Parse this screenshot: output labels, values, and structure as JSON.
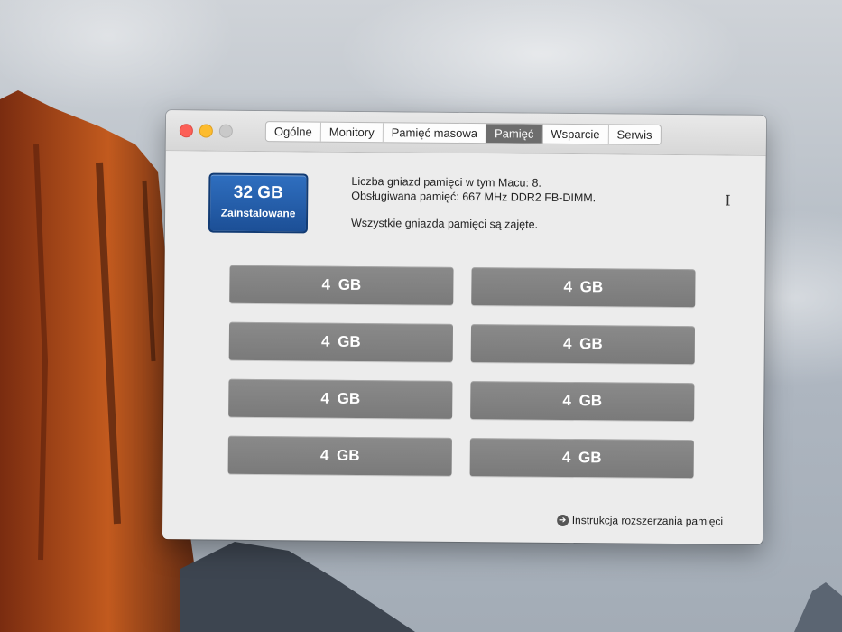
{
  "window": {
    "tabs": [
      {
        "label": "Ogólne",
        "active": false
      },
      {
        "label": "Monitory",
        "active": false
      },
      {
        "label": "Pamięć masowa",
        "active": false
      },
      {
        "label": "Pamięć",
        "active": true
      },
      {
        "label": "Wsparcie",
        "active": false
      },
      {
        "label": "Serwis",
        "active": false
      }
    ]
  },
  "memory": {
    "installed_size": "32 GB",
    "installed_label": "Zainstalowane",
    "slots_info": "Liczba gniazd pamięci w tym Macu: 8.",
    "supported_info": "Obsługiwana pamięć: 667 MHz DDR2 FB-DIMM.",
    "status_info": "Wszystkie gniazda pamięci są zajęte.",
    "slots": [
      "4 GB",
      "4 GB",
      "4 GB",
      "4 GB",
      "4 GB",
      "4 GB",
      "4 GB",
      "4 GB"
    ],
    "upgrade_link": "Instrukcja rozszerzania pamięci"
  },
  "colors": {
    "badge": "#1c4f96",
    "slot": "#7f7f7f",
    "active_tab": "#6d6d6d",
    "close": "#fc5f57",
    "minimize": "#fdbc2e",
    "zoom_disabled": "#c9c9c9"
  },
  "icons": {
    "link": "arrow-right-circle-icon",
    "cursor": "text-cursor-icon"
  }
}
